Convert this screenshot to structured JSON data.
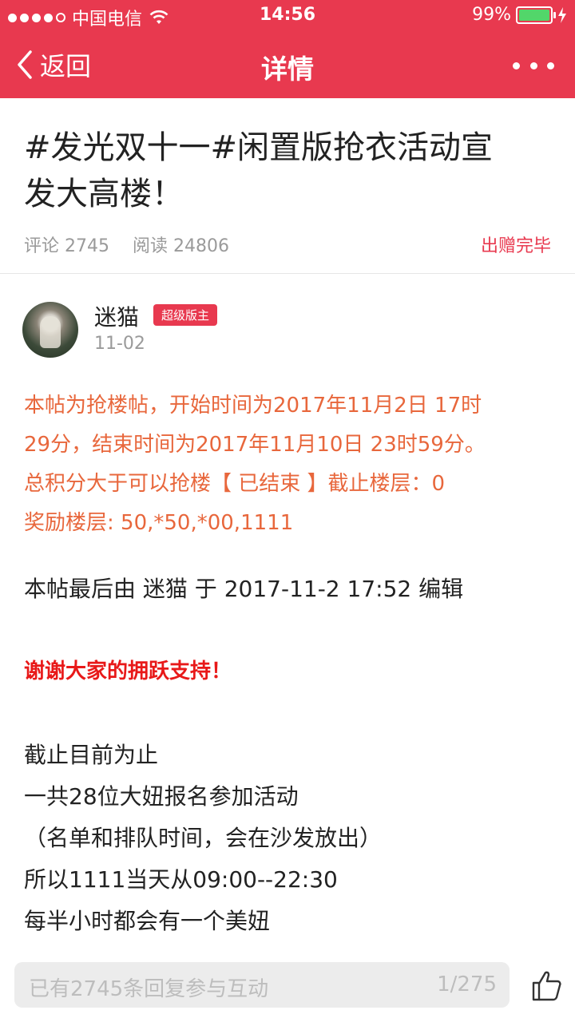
{
  "status_bar": {
    "carrier": "中国电信",
    "time": "14:56",
    "battery": "99%"
  },
  "nav": {
    "back_label": "返回",
    "title": "详情"
  },
  "post": {
    "title_line1": "#发光双十一#闲置版抢衣活动宣",
    "title_line2": "发大高楼！",
    "comments_label": "评论 2745",
    "reads_label": "阅读 24806",
    "status": "出赠完毕"
  },
  "author": {
    "name": "迷猫",
    "badge": "超级版主",
    "date": "11-02"
  },
  "notice": {
    "lines": [
      "本帖为抢楼帖，开始时间为2017年11月2日 17时",
      "29分，结束时间为2017年11月10日 23时59分。",
      "总积分大于可以抢楼【 已结束 】截止楼层：0",
      "奖励楼层: 50,*50,*00,1111"
    ]
  },
  "body": {
    "edited": "本帖最后由 迷猫 于 2017-11-2 17:52 编辑",
    "thanks": "谢谢大家的拥跃支持！",
    "lines": [
      "截止目前为止",
      "一共28位大妞报名参加活动",
      "（名单和排队时间，会在沙发放出）",
      "所以1111当天从09:00--22:30",
      "每半小时都会有一个美妞"
    ]
  },
  "reply_bar": {
    "placeholder": "已有2745条回复参与互动",
    "page": "1/275"
  },
  "colors": {
    "brand": "#e8394f",
    "notice": "#e8673c",
    "thanks": "#e81919"
  }
}
